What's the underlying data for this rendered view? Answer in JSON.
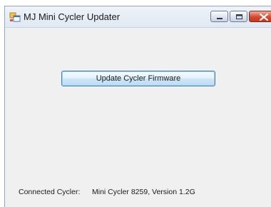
{
  "window": {
    "title": "MJ Mini Cycler Updater",
    "icons": [
      "app-icon",
      "minimize-icon",
      "maximize-icon",
      "close-icon"
    ]
  },
  "main": {
    "update_button_label": "Update Cycler Firmware",
    "connected_label": "Connected Cycler:",
    "connected_value": "Mini Cycler 8259, Version 1.2G"
  },
  "colors": {
    "close_button": "#d6492f",
    "update_button_border": "#3c7fb1",
    "window_background": "#f0f0f0"
  }
}
